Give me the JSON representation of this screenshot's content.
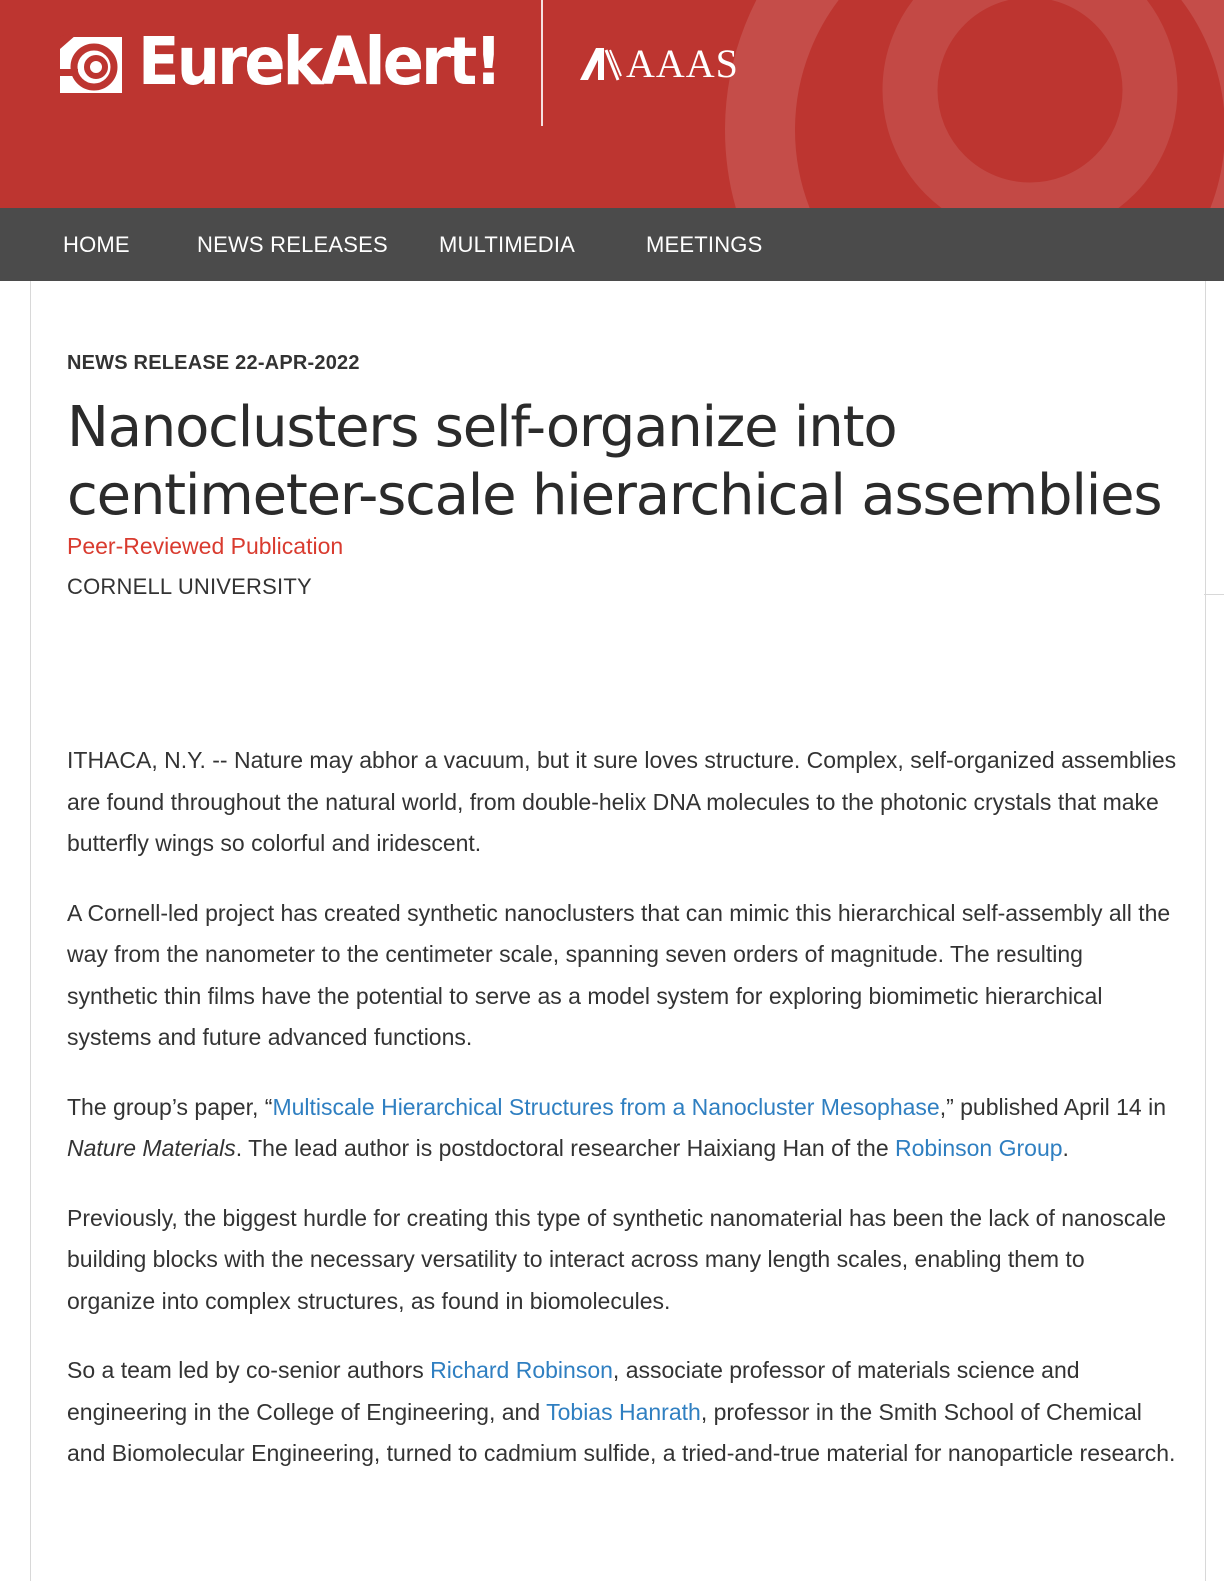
{
  "header": {
    "logo_text": "EurekAlert!",
    "partner_text": "AAAS",
    "brand_color": "#bd3530",
    "logo_icon": "swirl-icon",
    "partner_icon": "aaas-mark-icon"
  },
  "nav": {
    "items": [
      {
        "label": "HOME"
      },
      {
        "label": "NEWS RELEASES"
      },
      {
        "label": "MULTIMEDIA"
      },
      {
        "label": "MEETINGS"
      }
    ],
    "background": "#4b4b4b"
  },
  "article": {
    "meta": "NEWS RELEASE 22-APR-2022",
    "title": "Nanoclusters self-organize into centimeter-scale hierarchical assemblies",
    "peer_label": "Peer-Reviewed Publication",
    "institution": "CORNELL UNIVERSITY",
    "p1": "ITHACA, N.Y. -- Nature may abhor a vacuum, but it sure loves structure. Complex, self-organized assemblies are found throughout the natural world, from double-helix DNA molecules to the photonic crystals that make butterfly wings so colorful and iridescent.",
    "p2": "A Cornell-led project has created synthetic nanoclusters that can mimic this hierarchical self-assembly all the way from the nanometer to the centimeter scale, spanning seven orders of magnitude. The resulting synthetic thin films have the potential to serve as a model system for exploring biomimetic hierarchical systems and future advanced functions.",
    "p3": {
      "before": "The group’s paper, “",
      "link1": "Multiscale Hierarchical Structures from a Nanocluster Mesophase",
      "mid1": ",” published April 14 in ",
      "journal": "Nature Materials",
      "mid2": ". The lead author is postdoctoral researcher Haixiang Han of the ",
      "link2": "Robinson Group",
      "after": "."
    },
    "p4": "Previously, the biggest hurdle for creating this type of synthetic nanomaterial has been the lack of nanoscale building blocks with the necessary versatility to interact across many length scales, enabling them to organize into complex structures, as found in biomolecules.",
    "p5": {
      "before": "So a team led by co-senior authors ",
      "link1": "Richard Robinson",
      "mid1": ", associate professor of materials science and engineering in the College of Engineering, and ",
      "link2": "Tobias Hanrath",
      "after": ", professor in the Smith School of Chemical and Biomolecular Engineering, turned to cadmium sulfide, a tried-and-true material for nanoparticle research."
    },
    "link_color": "#2f7fc1",
    "peer_color": "#d93b2f"
  }
}
